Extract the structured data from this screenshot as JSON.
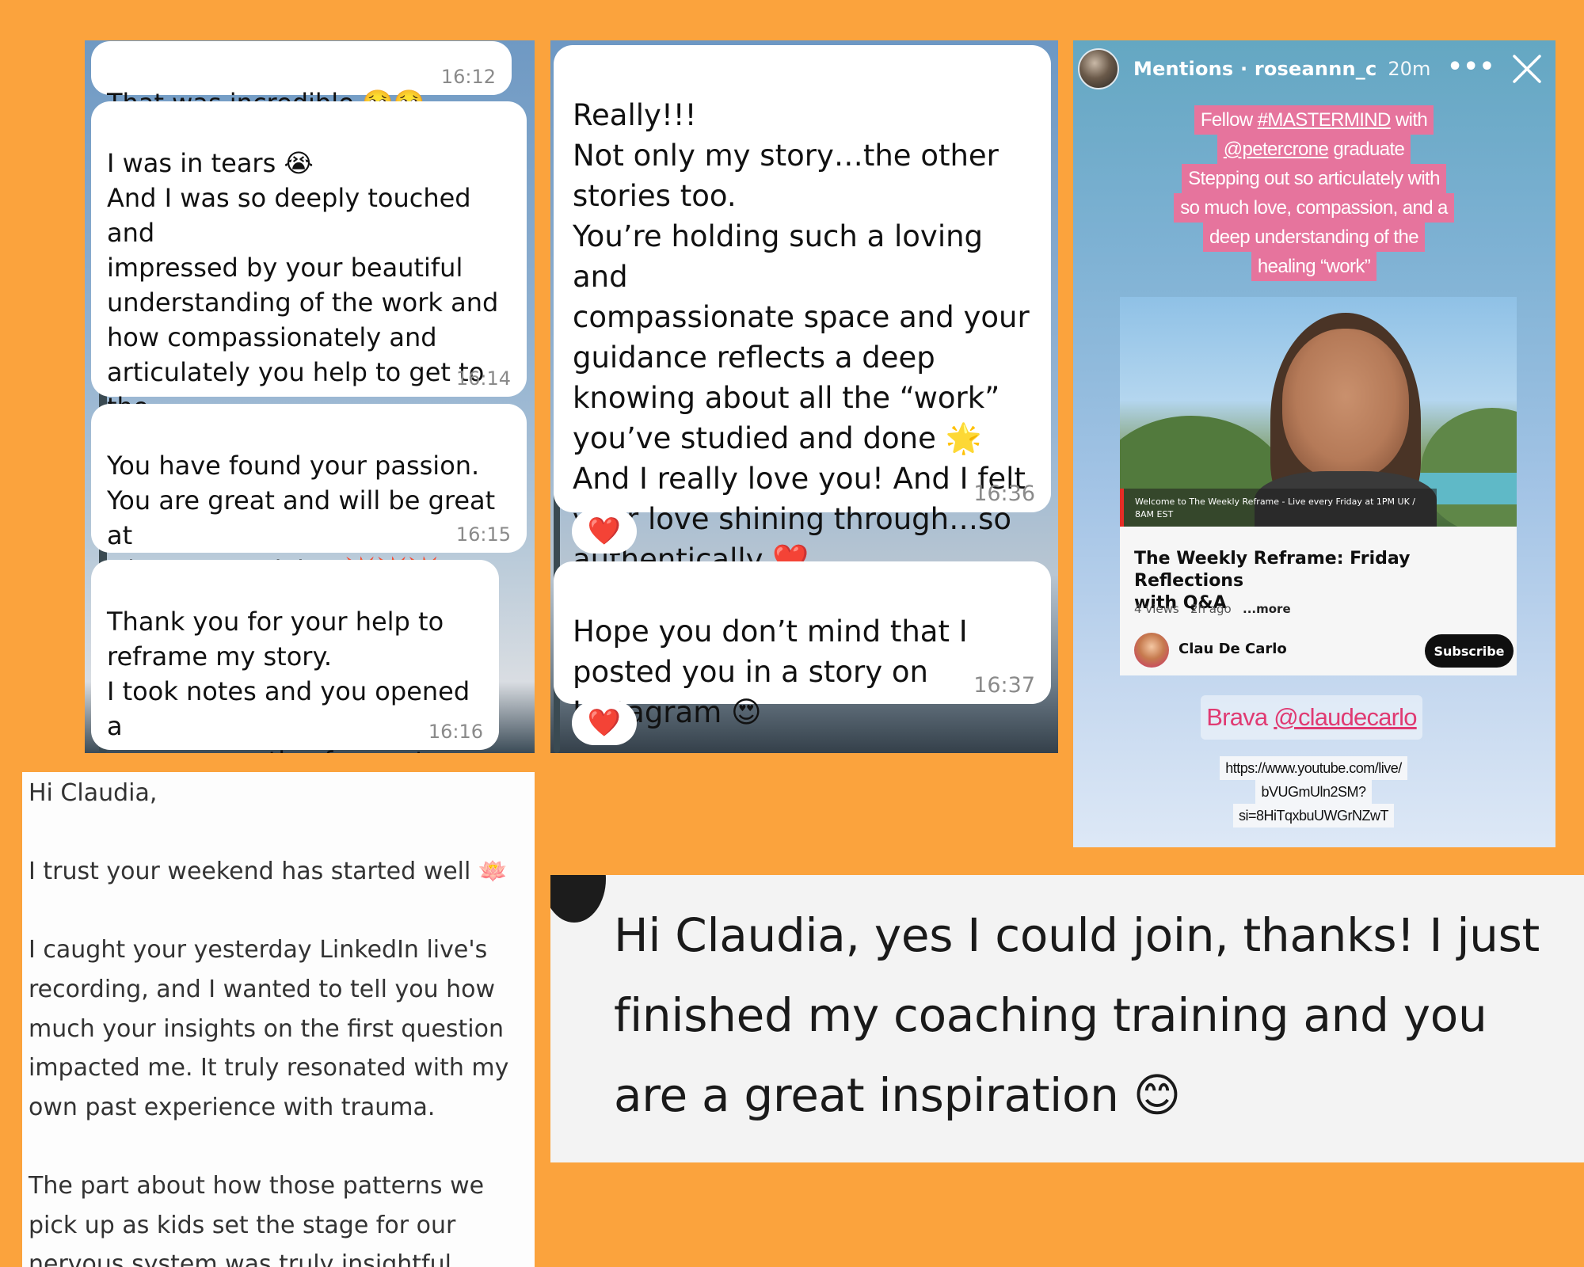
{
  "chat_left": {
    "messages": [
      {
        "text": "That was incredible 🥹🥹",
        "time": "16:12"
      },
      {
        "text": "I was in tears 😭\nAnd I was so deeply touched and\nimpressed by your beautiful\nunderstanding of the work and\nhow compassionately and\narticulately you help to get to the\nsource and teach how to begin\nto dissolve the “prisons”.",
        "time": "16:14"
      },
      {
        "text": "You have found your passion.\nYou are great and will be great at\nwhat you’re doing 💥💥💥",
        "time": "16:15"
      },
      {
        "text": "Thank you for your help to\nreframe my story.\nI took notes and you opened a\nnew perspective for me to\nexplore ❤️",
        "time": "16:16"
      }
    ]
  },
  "chat_middle": {
    "messages": [
      {
        "text": "Really!!!\nNot only my story…the other\nstories too.\nYou’re holding  such a loving and\ncompassionate space and your\nguidance reflects a deep\nknowing about all the “work”\nyou’ve studied and done 🌟\nAnd I really love you! And I felt\nyour love shining through…so\nauthentically ❤️",
        "time": "16:36",
        "reaction": "❤️"
      },
      {
        "text": "Hope you don’t mind that I\nposted you in a story on\nInstagram 😍",
        "time": "16:37",
        "reaction": "❤️"
      }
    ]
  },
  "story": {
    "header": {
      "label": "Mentions · roseannn_c",
      "time": "20m",
      "more": "•••"
    },
    "caption_lines": [
      {
        "pre": "Fellow ",
        "link": "#MASTERMIND",
        "post": " with"
      },
      {
        "pre": "",
        "link": "@petercrone",
        "post": " graduate"
      },
      {
        "pre": "Stepping out so articulately with",
        "link": "",
        "post": ""
      },
      {
        "pre": "so much love, compassion, and a",
        "link": "",
        "post": ""
      },
      {
        "pre": "deep understanding of the",
        "link": "",
        "post": ""
      },
      {
        "pre": "healing “work”",
        "link": "",
        "post": ""
      }
    ],
    "video": {
      "thumb_caption": "Welcome to The Weekly Reframe - Live every Friday at 1PM UK / 8AM EST",
      "title": "The Weekly Reframe: Friday Reflections\nwith Q&A",
      "views": "4 views",
      "age": "2h ago",
      "more": "...more",
      "channel": "Clau De Carlo",
      "subscribe": "Subscribe"
    },
    "brava": {
      "word": "Brava",
      "mention": "@claudecarlo"
    },
    "url_lines": [
      "https://www.youtube.com/live/",
      "bVUGmUln2SM?",
      "si=8HiTqxbuUWGrNZwT"
    ]
  },
  "email": {
    "lines": [
      "Hi Claudia,",
      "",
      "I trust your weekend has started well 🪷",
      "",
      "I caught your yesterday LinkedIn live's\nrecording, and I wanted to tell you how\nmuch your insights on the first question\nimpacted me. It truly resonated with my\nown past experience with trauma.",
      "",
      "The part about how those patterns we\npick up as kids set the stage for our\nnervous system was truly insightful."
    ]
  },
  "comment": {
    "text": "Hi Claudia, yes I could join, thanks! I just\nfinished my coaching training and you\nare a great inspiration 😊"
  },
  "colors": {
    "background": "#fba33d",
    "bubble": "#ffffff",
    "story_caption": "#e6749d",
    "brava_text": "#e03a72",
    "heart": "#e0102b"
  }
}
